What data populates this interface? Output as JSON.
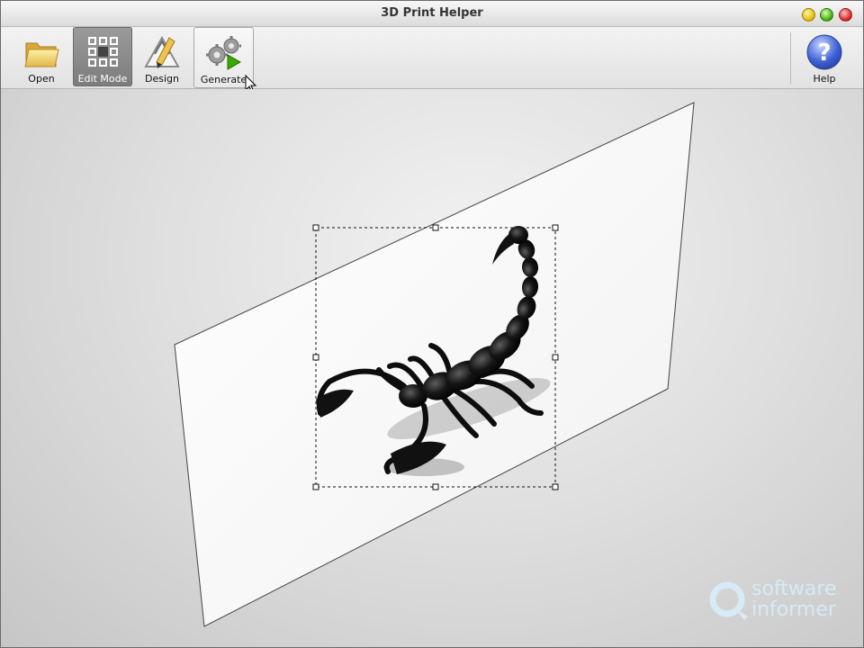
{
  "window": {
    "title": "3D Print Helper"
  },
  "toolbar": {
    "open_label": "Open",
    "edit_mode_label": "Edit Mode",
    "design_label": "Design",
    "generate_label": "Generate",
    "help_label": "Help"
  },
  "icons": [
    "folder-icon",
    "edit-mode-grid-icon",
    "design-compass-icon",
    "generate-gears-icon",
    "help-question-icon",
    "mouse-cursor-icon"
  ],
  "watermark": {
    "line1": "software",
    "line2": "informer"
  },
  "colors": {
    "accent_green": "#39a800",
    "help_blue": "#3f61d6",
    "watermark": "#d7edf7"
  }
}
